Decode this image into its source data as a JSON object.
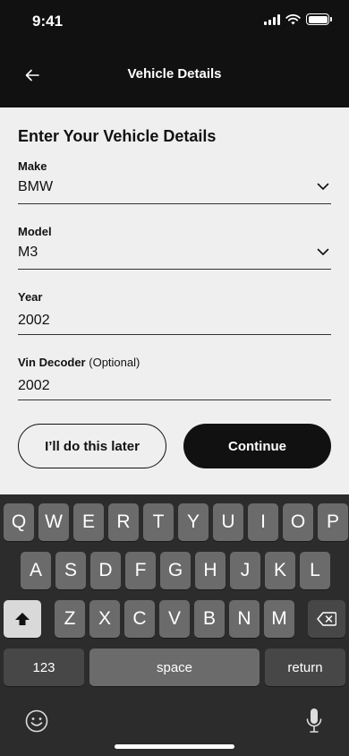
{
  "status_bar": {
    "time": "9:41"
  },
  "nav": {
    "title": "Vehicle Details",
    "back_icon": "arrow-left-icon"
  },
  "form": {
    "title": "Enter Your Vehicle Details",
    "make": {
      "label": "Make",
      "value": "BMW"
    },
    "model": {
      "label": "Model",
      "value": "M3"
    },
    "year": {
      "label": "Year",
      "value": "2002"
    },
    "vin": {
      "label": "Vin Decoder",
      "optional": "(Optional)",
      "value": "2002"
    }
  },
  "buttons": {
    "later": "I’ll do this later",
    "continue": "Continue"
  },
  "keyboard": {
    "row1": [
      "Q",
      "W",
      "E",
      "R",
      "T",
      "Y",
      "U",
      "I",
      "O",
      "P"
    ],
    "row2": [
      "A",
      "S",
      "D",
      "F",
      "G",
      "H",
      "J",
      "K",
      "L"
    ],
    "row3": [
      "Z",
      "X",
      "C",
      "V",
      "B",
      "N",
      "M"
    ],
    "numbers": "123",
    "space": "space",
    "return": "return"
  },
  "colors": {
    "header_bg": "#111111",
    "page_bg": "#efefef",
    "keyboard_bg": "#2c2c2c",
    "key_bg": "#6b6b6b"
  }
}
